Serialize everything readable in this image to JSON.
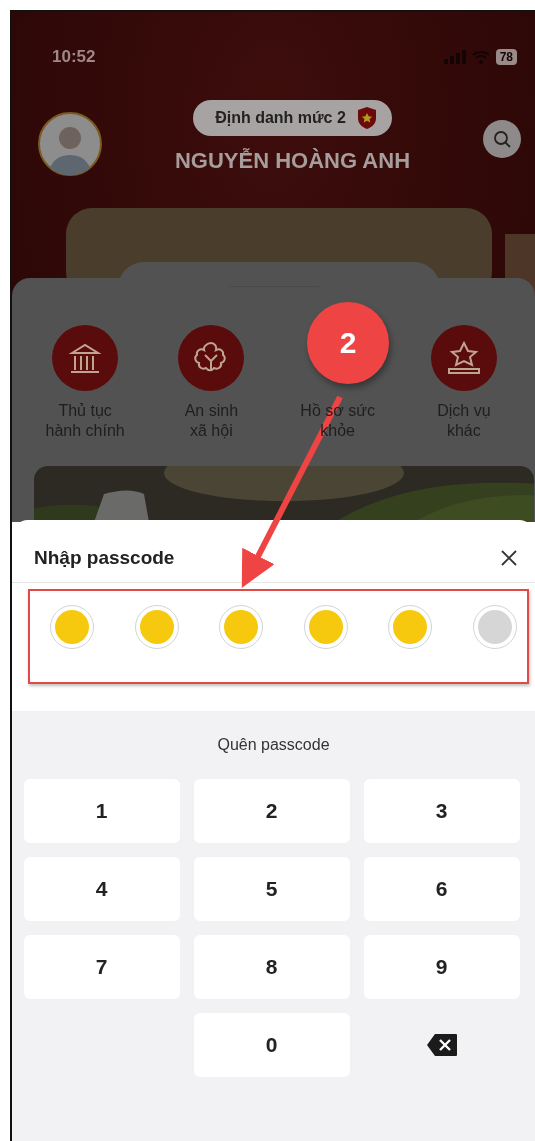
{
  "status_bar": {
    "time": "10:52",
    "battery": "78"
  },
  "header": {
    "badge": "Định danh mức 2",
    "name": "NGUYỄN HOÀNG ANH"
  },
  "services": [
    {
      "label": "Thủ tục\nhành chính",
      "kind": "building"
    },
    {
      "label": "An sinh\nxã hội",
      "kind": "flower"
    },
    {
      "label": "Hồ sơ sức\nkhỏe",
      "kind": "hidden"
    },
    {
      "label": "Dịch vụ\nkhác",
      "kind": "star"
    }
  ],
  "passcode": {
    "title": "Nhập passcode",
    "digits": [
      {
        "filled": true
      },
      {
        "filled": true
      },
      {
        "filled": true
      },
      {
        "filled": true
      },
      {
        "filled": true
      },
      {
        "filled": false
      }
    ],
    "forgot": "Quên passcode"
  },
  "keypad": [
    {
      "kind": "digit",
      "label": "1"
    },
    {
      "kind": "digit",
      "label": "2"
    },
    {
      "kind": "digit",
      "label": "3"
    },
    {
      "kind": "digit",
      "label": "4"
    },
    {
      "kind": "digit",
      "label": "5"
    },
    {
      "kind": "digit",
      "label": "6"
    },
    {
      "kind": "digit",
      "label": "7"
    },
    {
      "kind": "digit",
      "label": "8"
    },
    {
      "kind": "digit",
      "label": "9"
    },
    {
      "kind": "empty"
    },
    {
      "kind": "digit",
      "label": "0"
    },
    {
      "kind": "delete"
    }
  ],
  "annotation": {
    "number": "2"
  }
}
